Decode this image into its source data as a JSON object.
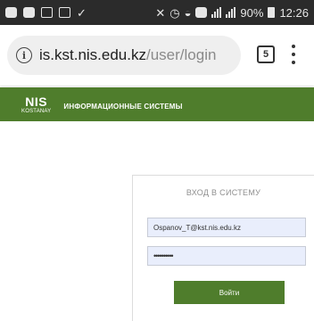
{
  "status_bar": {
    "battery": "90%",
    "time": "12:26"
  },
  "browser": {
    "url_host": "is.kst.nis.edu.kz",
    "url_path": "/user/login",
    "tab_count": "5"
  },
  "header": {
    "logo_main": "NIS",
    "logo_sub": "KOSTANAY",
    "title": "ИНФОРМАЦИОННЫЕ СИСТЕМЫ",
    "background": "#4f7d2c"
  },
  "login": {
    "title": "ВХОД В СИСТЕМУ",
    "username_value": "Ospanov_T@kst.nis.edu.kz",
    "password_value": "••••••••••",
    "button_label": "Войти"
  }
}
